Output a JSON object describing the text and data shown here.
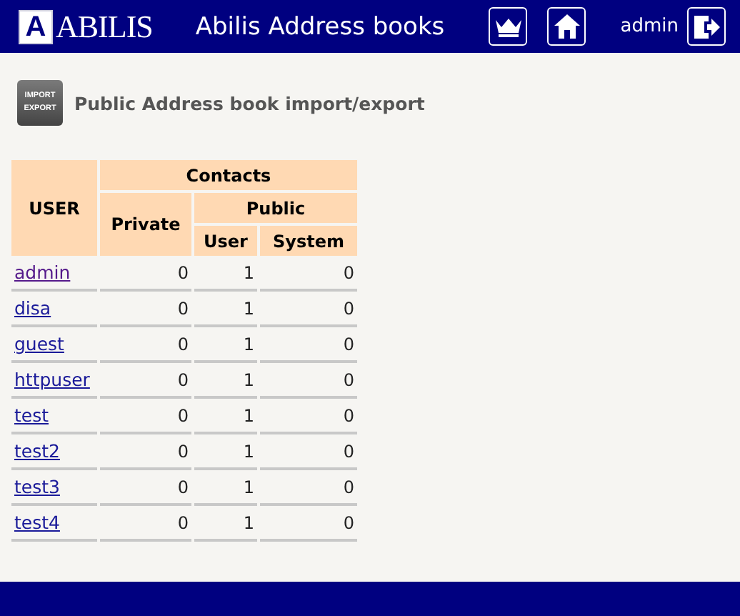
{
  "header": {
    "logo_letter": "A",
    "logo_text": "ABILIS",
    "title": "Abilis Address books",
    "user": "admin"
  },
  "section": {
    "icon_lines": [
      "IMPORT",
      "EXPORT"
    ],
    "title": "Public Address book import/export"
  },
  "table": {
    "headers": {
      "user": "USER",
      "contacts": "Contacts",
      "private": "Private",
      "public": "Public",
      "public_user": "User",
      "public_system": "System"
    },
    "rows": [
      {
        "user": "admin",
        "visited": true,
        "private": "0",
        "public_user": "1",
        "public_system": "0"
      },
      {
        "user": "disa",
        "visited": false,
        "private": "0",
        "public_user": "1",
        "public_system": "0"
      },
      {
        "user": "guest",
        "visited": false,
        "private": "0",
        "public_user": "1",
        "public_system": "0"
      },
      {
        "user": "httpuser",
        "visited": false,
        "private": "0",
        "public_user": "1",
        "public_system": "0"
      },
      {
        "user": "test",
        "visited": false,
        "private": "0",
        "public_user": "1",
        "public_system": "0"
      },
      {
        "user": "test2",
        "visited": false,
        "private": "0",
        "public_user": "1",
        "public_system": "0"
      },
      {
        "user": "test3",
        "visited": false,
        "private": "0",
        "public_user": "1",
        "public_system": "0"
      },
      {
        "user": "test4",
        "visited": false,
        "private": "0",
        "public_user": "1",
        "public_system": "0"
      }
    ]
  }
}
